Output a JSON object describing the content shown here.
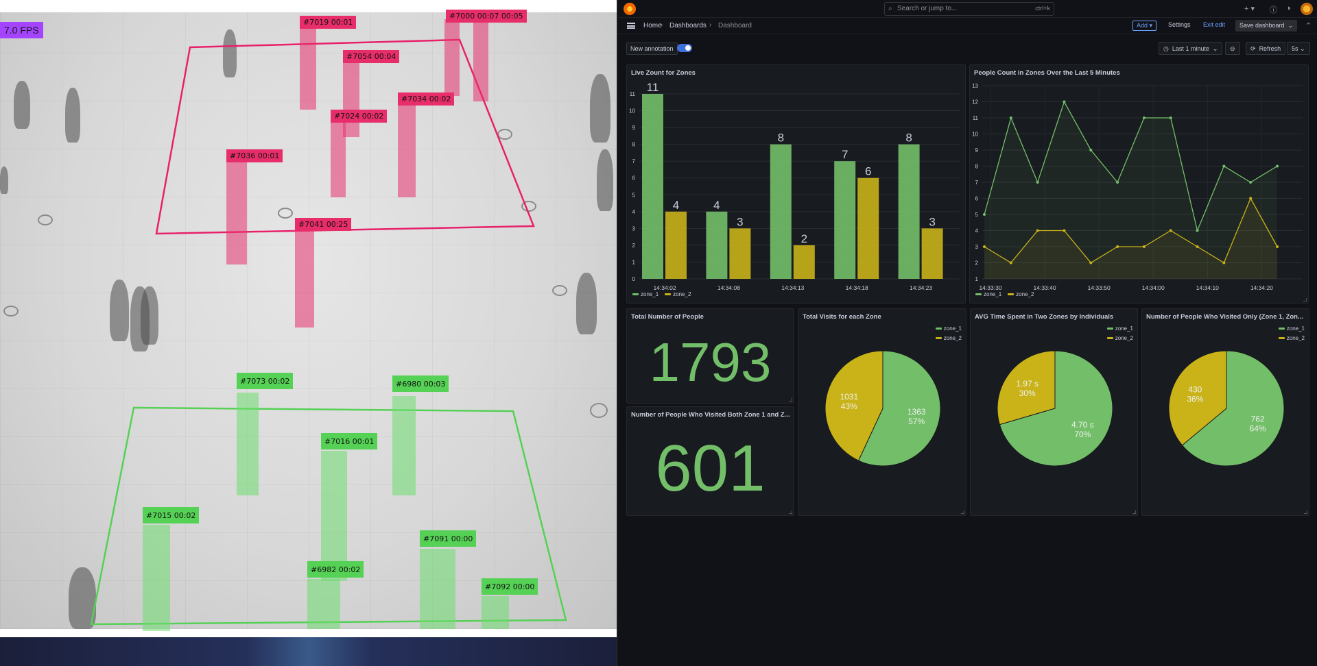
{
  "video": {
    "fps": "7.0 FPS",
    "red_tracks": [
      {
        "label": "#7019 00:01"
      },
      {
        "label": "#7054 00:04"
      },
      {
        "label": "#7034 00:02"
      },
      {
        "label": "#7024 00:02"
      },
      {
        "label": "#7036 00:01"
      },
      {
        "label": "#7041 00:25"
      },
      {
        "label": "#7000 00:07 00:05"
      }
    ],
    "green_tracks": [
      {
        "label": "#7073 00:02"
      },
      {
        "label": "#6980 00:03"
      },
      {
        "label": "#7016 00:01"
      },
      {
        "label": "#7015 00:02"
      },
      {
        "label": "#7091 00:00"
      },
      {
        "label": "#6982 00:02"
      },
      {
        "label": "#7092 00:00"
      }
    ]
  },
  "topbar": {
    "search_placeholder": "Search or jump to...",
    "search_shortcut": "ctrl+k",
    "plus_icon": "+",
    "help_icon": "?",
    "news_icon": "rss-icon"
  },
  "breadcrumb": {
    "home": "Home",
    "dashboards": "Dashboards",
    "current": "Dashboard"
  },
  "toolbar": {
    "add_label": "Add",
    "settings_label": "Settings",
    "exit_edit_label": "Exit edit",
    "save_label": "Save dashboard"
  },
  "controls": {
    "annotation_label": "New annotation",
    "time_range": "Last 1 minute",
    "refresh_label": "Refresh",
    "refresh_interval": "5s"
  },
  "colors": {
    "zone_1": "#73bf69",
    "zone_2": "#c9b318",
    "stat_green": "#73bf69",
    "panel_bg": "#181b1f"
  },
  "panels": {
    "live_count": {
      "title": "Live Zount for Zones",
      "legend": [
        "zone_1",
        "zone_2"
      ]
    },
    "people_5min": {
      "title": "People Count in Zones Over the Last 5 Minutes",
      "legend": [
        "zone_1",
        "zone_2"
      ]
    },
    "total_people": {
      "title": "Total Number of People",
      "value": "1793"
    },
    "both_zones": {
      "title": "Number of People Who Visited Both Zone 1 and Z...",
      "value": "601"
    },
    "total_visits": {
      "title": "Total Visits for each Zone",
      "legend": [
        "zone_1",
        "zone_2"
      ],
      "slices": [
        {
          "name": "zone_1",
          "value": 1363,
          "value_label": "1363",
          "pct": "57%"
        },
        {
          "name": "zone_2",
          "value": 1031,
          "value_label": "1031",
          "pct": "43%"
        }
      ]
    },
    "avg_time": {
      "title": "AVG Time Spent in Two Zones by Individuals",
      "legend": [
        "zone_1",
        "zone_2"
      ],
      "slices": [
        {
          "name": "zone_1",
          "value": 4.7,
          "value_label": "4.70 s",
          "pct": "70%"
        },
        {
          "name": "zone_2",
          "value": 1.97,
          "value_label": "1.97 s",
          "pct": "30%"
        }
      ]
    },
    "only_one": {
      "title": "Number of People Who Visited Only (Zone 1, Zon...",
      "legend": [
        "zone_1",
        "zone_2"
      ],
      "slices": [
        {
          "name": "zone_1",
          "value": 762,
          "value_label": "762",
          "pct": "64%"
        },
        {
          "name": "zone_2",
          "value": 430,
          "value_label": "430",
          "pct": "36%"
        }
      ]
    }
  },
  "chart_data": [
    {
      "type": "bar",
      "title": "Live Zount for Zones",
      "categories": [
        "14:34:02",
        "14:34:08",
        "14:34:13",
        "14:34:18",
        "14:34:23"
      ],
      "series": [
        {
          "name": "zone_1",
          "values": [
            11,
            4,
            8,
            7,
            8
          ]
        },
        {
          "name": "zone_2",
          "values": [
            4,
            3,
            2,
            6,
            3
          ]
        }
      ],
      "ylim": [
        0,
        11
      ],
      "yticks": [
        0,
        1,
        2,
        3,
        4,
        5,
        6,
        7,
        8,
        9,
        10,
        11
      ],
      "legend": "bottom-left"
    },
    {
      "type": "line",
      "title": "People Count in Zones Over the Last 5 Minutes",
      "x_tick_labels": [
        "14:33:30",
        "14:33:40",
        "14:33:50",
        "14:34:00",
        "14:34:10",
        "14:34:20"
      ],
      "series": [
        {
          "name": "zone_1",
          "values": [
            5,
            11,
            7,
            12,
            9,
            7,
            11,
            11,
            4,
            8,
            7,
            8
          ]
        },
        {
          "name": "zone_2",
          "values": [
            3,
            2,
            4,
            4,
            2,
            3,
            3,
            4,
            3,
            2,
            6,
            3
          ]
        }
      ],
      "ylim": [
        1,
        13
      ],
      "yticks": [
        1,
        2,
        3,
        4,
        5,
        6,
        7,
        8,
        9,
        10,
        11,
        12,
        13
      ],
      "legend": "bottom-left"
    }
  ]
}
